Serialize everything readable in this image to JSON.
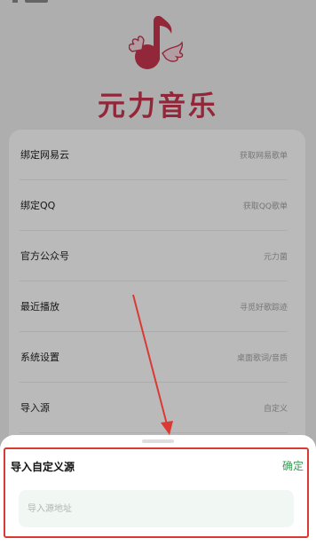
{
  "brand": {
    "name": "元力音乐"
  },
  "menu": {
    "items": [
      {
        "label": "绑定网易云",
        "hint": "获取网易歌单"
      },
      {
        "label": "绑定QQ",
        "hint": "获取QQ歌单"
      },
      {
        "label": "官方公众号",
        "hint": "元力菌"
      },
      {
        "label": "最近播放",
        "hint": "寻觅好歌踪迹"
      },
      {
        "label": "系统设置",
        "hint": "桌面歌词/音质"
      },
      {
        "label": "导入源",
        "hint": "自定义"
      }
    ]
  },
  "sheet": {
    "title": "导入自定义源",
    "confirm_label": "确定",
    "input_placeholder": "导入源地址",
    "input_value": ""
  },
  "colors": {
    "brand": "#c9364f",
    "confirm": "#3a9b55",
    "highlight": "#d93a33"
  },
  "icons": {
    "logo": "winged-music-note-icon"
  }
}
